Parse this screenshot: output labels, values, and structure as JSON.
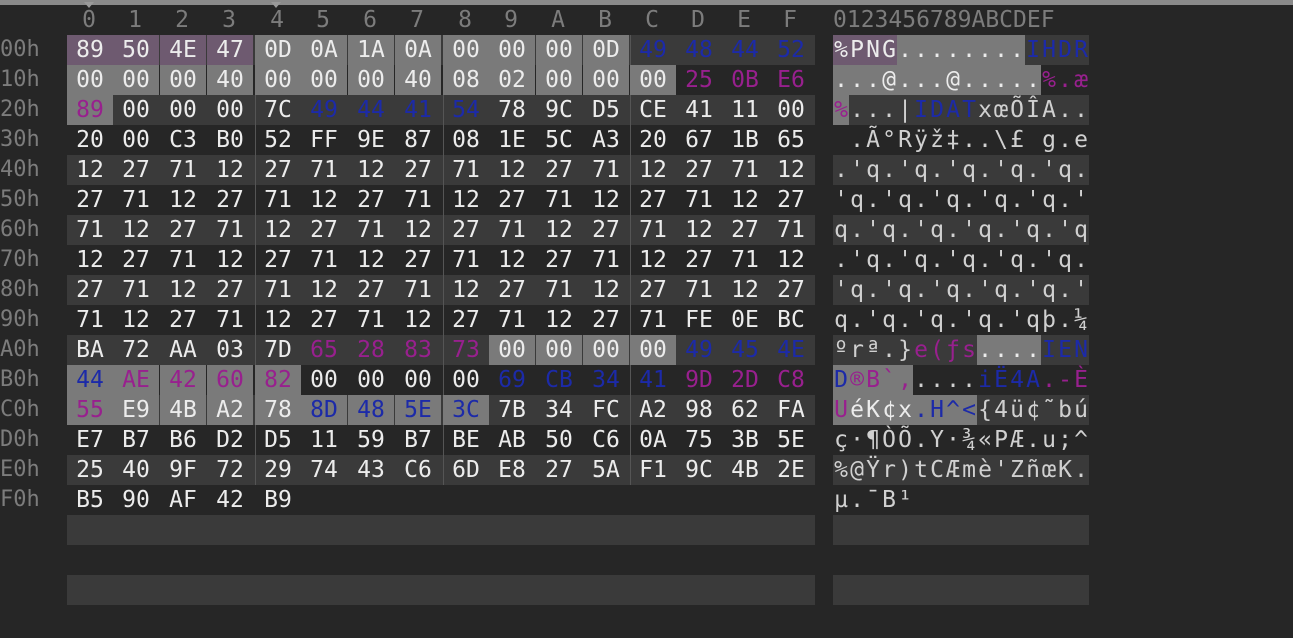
{
  "column_headers": [
    "0",
    "1",
    "2",
    "3",
    "4",
    "5",
    "6",
    "7",
    "8",
    "9",
    "A",
    "B",
    "C",
    "D",
    "E",
    "F"
  ],
  "ascii_header": "0123456789ABCDEF",
  "rows": [
    {
      "label": "00h",
      "hex": [
        "89",
        "50",
        "4E",
        "47",
        "0D",
        "0A",
        "1A",
        "0A",
        "00",
        "00",
        "00",
        "0D",
        "49",
        "48",
        "44",
        "52"
      ],
      "ascii": "%PNG........IHDR"
    },
    {
      "label": "10h",
      "hex": [
        "00",
        "00",
        "00",
        "40",
        "00",
        "00",
        "00",
        "40",
        "08",
        "02",
        "00",
        "00",
        "00",
        "25",
        "0B",
        "E6"
      ],
      "ascii": "...@...@.....%.æ"
    },
    {
      "label": "20h",
      "hex": [
        "89",
        "00",
        "00",
        "00",
        "7C",
        "49",
        "44",
        "41",
        "54",
        "78",
        "9C",
        "D5",
        "CE",
        "41",
        "11",
        "00"
      ],
      "ascii": "%...|IDATxœÕÎA.."
    },
    {
      "label": "30h",
      "hex": [
        "20",
        "00",
        "C3",
        "B0",
        "52",
        "FF",
        "9E",
        "87",
        "08",
        "1E",
        "5C",
        "A3",
        "20",
        "67",
        "1B",
        "65"
      ],
      "ascii": " .Ã°Rÿž‡..\\£ g.e"
    },
    {
      "label": "40h",
      "hex": [
        "12",
        "27",
        "71",
        "12",
        "27",
        "71",
        "12",
        "27",
        "71",
        "12",
        "27",
        "71",
        "12",
        "27",
        "71",
        "12"
      ],
      "ascii": ".'q.'q.'q.'q.'q."
    },
    {
      "label": "50h",
      "hex": [
        "27",
        "71",
        "12",
        "27",
        "71",
        "12",
        "27",
        "71",
        "12",
        "27",
        "71",
        "12",
        "27",
        "71",
        "12",
        "27"
      ],
      "ascii": "'q.'q.'q.'q.'q.'"
    },
    {
      "label": "60h",
      "hex": [
        "71",
        "12",
        "27",
        "71",
        "12",
        "27",
        "71",
        "12",
        "27",
        "71",
        "12",
        "27",
        "71",
        "12",
        "27",
        "71"
      ],
      "ascii": "q.'q.'q.'q.'q.'q"
    },
    {
      "label": "70h",
      "hex": [
        "12",
        "27",
        "71",
        "12",
        "27",
        "71",
        "12",
        "27",
        "71",
        "12",
        "27",
        "71",
        "12",
        "27",
        "71",
        "12"
      ],
      "ascii": ".'q.'q.'q.'q.'q."
    },
    {
      "label": "80h",
      "hex": [
        "27",
        "71",
        "12",
        "27",
        "71",
        "12",
        "27",
        "71",
        "12",
        "27",
        "71",
        "12",
        "27",
        "71",
        "12",
        "27"
      ],
      "ascii": "'q.'q.'q.'q.'q.'"
    },
    {
      "label": "90h",
      "hex": [
        "71",
        "12",
        "27",
        "71",
        "12",
        "27",
        "71",
        "12",
        "27",
        "71",
        "12",
        "27",
        "71",
        "FE",
        "0E",
        "BC"
      ],
      "ascii": "q.'q.'q.'q.'qþ.¼"
    },
    {
      "label": "A0h",
      "hex": [
        "BA",
        "72",
        "AA",
        "03",
        "7D",
        "65",
        "28",
        "83",
        "73",
        "00",
        "00",
        "00",
        "00",
        "49",
        "45",
        "4E"
      ],
      "ascii": "ºrª.}e(ƒs....IEN"
    },
    {
      "label": "B0h",
      "hex": [
        "44",
        "AE",
        "42",
        "60",
        "82",
        "00",
        "00",
        "00",
        "00",
        "69",
        "CB",
        "34",
        "41",
        "9D",
        "2D",
        "C8"
      ],
      "ascii": "D®B`‚....iË4A.-È"
    },
    {
      "label": "C0h",
      "hex": [
        "55",
        "E9",
        "4B",
        "A2",
        "78",
        "8D",
        "48",
        "5E",
        "3C",
        "7B",
        "34",
        "FC",
        "A2",
        "98",
        "62",
        "FA"
      ],
      "ascii": "UéK¢x.H^<{4ü¢˜bú"
    },
    {
      "label": "D0h",
      "hex": [
        "E7",
        "B7",
        "B6",
        "D2",
        "D5",
        "11",
        "59",
        "B7",
        "BE",
        "AB",
        "50",
        "C6",
        "0A",
        "75",
        "3B",
        "5E"
      ],
      "ascii": "ç·¶ÒÕ.Y·¾«PÆ.u;^"
    },
    {
      "label": "E0h",
      "hex": [
        "25",
        "40",
        "9F",
        "72",
        "29",
        "74",
        "43",
        "C6",
        "6D",
        "E8",
        "27",
        "5A",
        "F1",
        "9C",
        "4B",
        "2E"
      ],
      "ascii": "%@Ÿr)tCÆmè'ZñœK."
    },
    {
      "label": "F0h",
      "hex": [
        "B5",
        "90",
        "AF",
        "42",
        "B9"
      ],
      "ascii": "µ.¯B¹"
    }
  ],
  "colors": {
    "background": "#262626",
    "stripe": "#3a3a3a",
    "selection": "#7a7a7a",
    "chunk_type": "#1c2aa8",
    "crc": "#98208e",
    "header_gray": "#7c7c7c"
  }
}
